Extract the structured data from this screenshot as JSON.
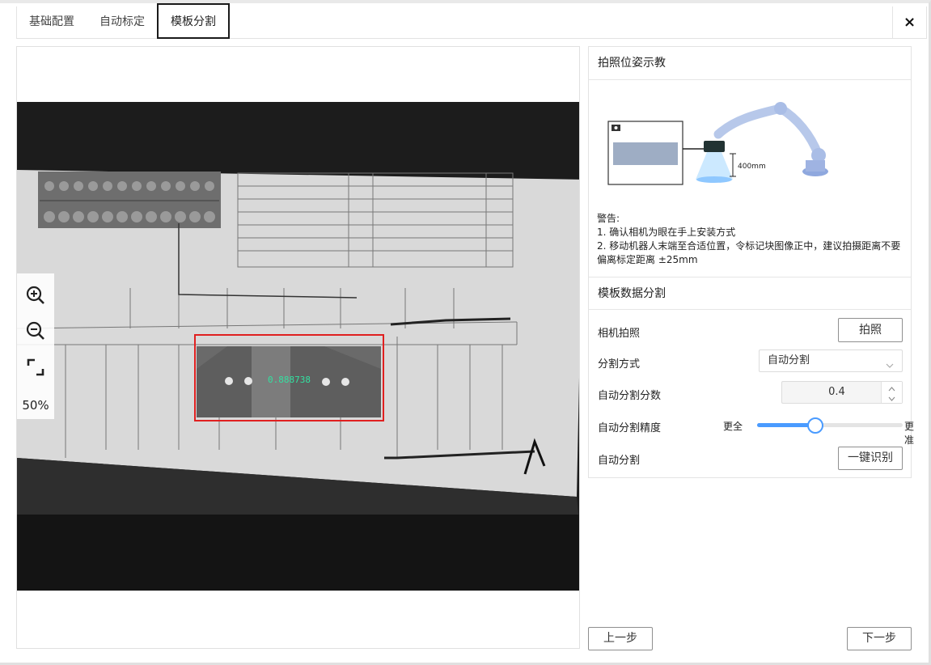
{
  "tabs": [
    {
      "label": "基础配置"
    },
    {
      "label": "自动标定"
    },
    {
      "label": "模板分割"
    }
  ],
  "close_label": "×",
  "viewer": {
    "zoom_level": "50%",
    "detection_score": "0.888738"
  },
  "pose": {
    "title": "拍照位姿示教",
    "distance_label": "400mm",
    "warning_title": "警告:",
    "warning_lines": [
      "1. 确认相机为眼在手上安装方式",
      "2. 移动机器人末端至合适位置，令标记块图像正中，建议拍摄距离不要偏离标定距离 ±25mm"
    ]
  },
  "segmentation": {
    "title": "模板数据分割",
    "camera_label": "相机拍照",
    "camera_button": "拍照",
    "method_label": "分割方式",
    "method_value": "自动分割",
    "score_label": "自动分割分数",
    "score_value": "0.4",
    "precision_label": "自动分割精度",
    "precision_min_label": "更全",
    "precision_max_label": "更准",
    "precision_fraction": 0.4,
    "auto_label": "自动分割",
    "auto_button": "一键识别"
  },
  "footer": {
    "prev_label": "上一步",
    "next_label": "下一步"
  },
  "colors": {
    "accent": "#4a9bff",
    "detection_box": "#e02020",
    "detection_text": "#33e0a0"
  },
  "icons": [
    "zoom-in-icon",
    "zoom-out-icon",
    "fit-screen-icon",
    "close-icon",
    "chevron-down-icon",
    "camera-icon"
  ]
}
